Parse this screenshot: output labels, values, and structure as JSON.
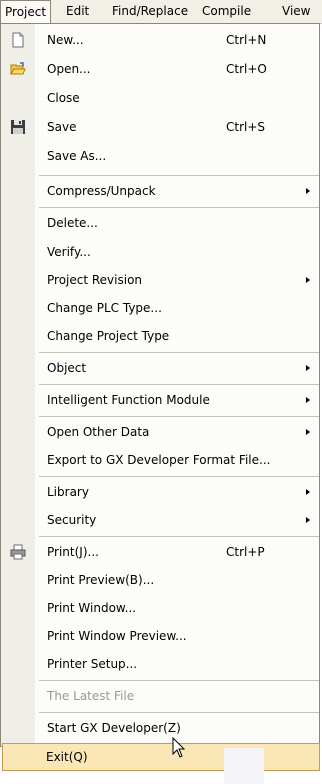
{
  "menubar": {
    "items": [
      {
        "label": "Project"
      },
      {
        "label": "Edit"
      },
      {
        "label": "Find/Replace"
      },
      {
        "label": "Compile"
      },
      {
        "label": "View"
      }
    ]
  },
  "menu": {
    "items": [
      {
        "label": "New...",
        "shortcut": "Ctrl+N",
        "icon": "new-file-icon"
      },
      {
        "label": "Open...",
        "shortcut": "Ctrl+O",
        "icon": "open-folder-icon"
      },
      {
        "label": "Close"
      },
      {
        "label": "Save",
        "shortcut": "Ctrl+S",
        "icon": "save-disk-icon"
      },
      {
        "label": "Save As..."
      },
      {
        "label": "Compress/Unpack",
        "submenu": true
      },
      {
        "label": "Delete..."
      },
      {
        "label": "Verify..."
      },
      {
        "label": "Project Revision",
        "submenu": true
      },
      {
        "label": "Change PLC Type..."
      },
      {
        "label": "Change Project Type"
      },
      {
        "label": "Object",
        "submenu": true
      },
      {
        "label": "Intelligent Function Module",
        "submenu": true
      },
      {
        "label": "Open Other Data",
        "submenu": true
      },
      {
        "label": "Export to GX Developer Format File..."
      },
      {
        "label": "Library",
        "submenu": true
      },
      {
        "label": "Security",
        "submenu": true
      },
      {
        "label": "Print(J)...",
        "shortcut": "Ctrl+P",
        "icon": "printer-icon"
      },
      {
        "label": "Print Preview(B)..."
      },
      {
        "label": "Print Window..."
      },
      {
        "label": "Print Window Preview..."
      },
      {
        "label": "Printer Setup..."
      },
      {
        "label": "The Latest File",
        "disabled": true
      },
      {
        "label": "Start GX Developer(Z)"
      },
      {
        "label": "Exit(Q)",
        "highlight": true
      }
    ]
  },
  "colors": {
    "menubar_bg": "#f1efe6",
    "menu_bg": "#fcfcf9",
    "gutter_bg": "#f0efe7",
    "highlight_bg": "#fbe7b6",
    "highlight_border": "#c69b53",
    "disabled_text": "#9a9a94"
  }
}
